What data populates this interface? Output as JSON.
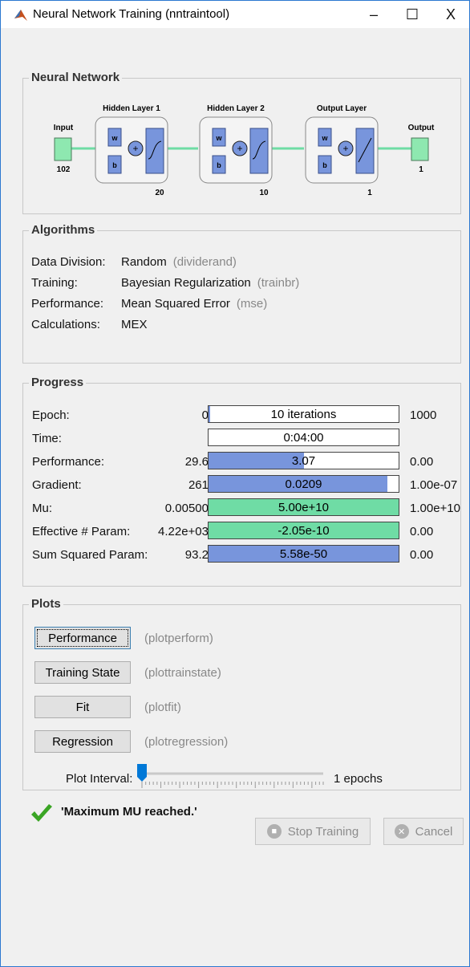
{
  "window": {
    "title": "Neural Network Training (nntraintool)",
    "controls": {
      "minimize": "–",
      "maximize": "☐",
      "close": "X"
    }
  },
  "network": {
    "panel_title": "Neural Network",
    "input_label": "Input",
    "input_size": "102",
    "hidden1_title": "Hidden Layer 1",
    "hidden1_size": "20",
    "hidden2_title": "Hidden Layer 2",
    "hidden2_size": "10",
    "output_layer_title": "Output Layer",
    "output_layer_size": "1",
    "output_label": "Output",
    "output_size": "1",
    "weight_label": "w",
    "bias_label": "b",
    "sum_symbol": "+"
  },
  "algorithms": {
    "panel_title": "Algorithms",
    "rows": [
      {
        "label": "Data Division:",
        "value": "Random",
        "fn": "(dividerand)"
      },
      {
        "label": "Training:",
        "value": "Bayesian Regularization",
        "fn": "(trainbr)"
      },
      {
        "label": "Performance:",
        "value": "Mean Squared Error",
        "fn": "(mse)"
      },
      {
        "label": "Calculations:",
        "value": "MEX",
        "fn": ""
      }
    ]
  },
  "progress": {
    "panel_title": "Progress",
    "rows": [
      {
        "label": "Epoch:",
        "start": "0",
        "bar_text": "10 iterations",
        "end": "1000",
        "fill": 0.01,
        "color": "#7895dc"
      },
      {
        "label": "Time:",
        "start": "",
        "bar_text": "0:04:00",
        "end": "",
        "fill": 0,
        "color": "#7895dc"
      },
      {
        "label": "Performance:",
        "start": "29.6",
        "bar_text": "3.07",
        "end": "0.00",
        "fill": 0.5,
        "color": "#7895dc"
      },
      {
        "label": "Gradient:",
        "start": "261",
        "bar_text": "0.0209",
        "end": "1.00e-07",
        "fill": 0.94,
        "color": "#7895dc"
      },
      {
        "label": "Mu:",
        "start": "0.00500",
        "bar_text": "5.00e+10",
        "end": "1.00e+10",
        "fill": 1.0,
        "color": "#6fdca5"
      },
      {
        "label": "Effective # Param:",
        "start": "4.22e+03",
        "bar_text": "-2.05e-10",
        "end": "0.00",
        "fill": 1.0,
        "color": "#6fdca5"
      },
      {
        "label": "Sum Squared Param:",
        "start": "93.2",
        "bar_text": "5.58e-50",
        "end": "0.00",
        "fill": 1.0,
        "color": "#7895dc"
      }
    ]
  },
  "plots": {
    "panel_title": "Plots",
    "buttons": [
      {
        "label": "Performance",
        "fn": "(plotperform)"
      },
      {
        "label": "Training State",
        "fn": "(plottrainstate)"
      },
      {
        "label": "Fit",
        "fn": "(plotfit)"
      },
      {
        "label": "Regression",
        "fn": "(plotregression)"
      }
    ],
    "interval_label": "Plot Interval:",
    "interval_value": "1 epochs",
    "slider_fraction": 0.0
  },
  "status": {
    "message": "'Maximum MU reached.'"
  },
  "footer": {
    "stop_label": "Stop Training",
    "cancel_label": "Cancel"
  },
  "colors": {
    "accent_blue": "#7895dc",
    "accent_green": "#6fdca5",
    "node_green": "#8ee8b0",
    "check_green": "#3aa524"
  }
}
